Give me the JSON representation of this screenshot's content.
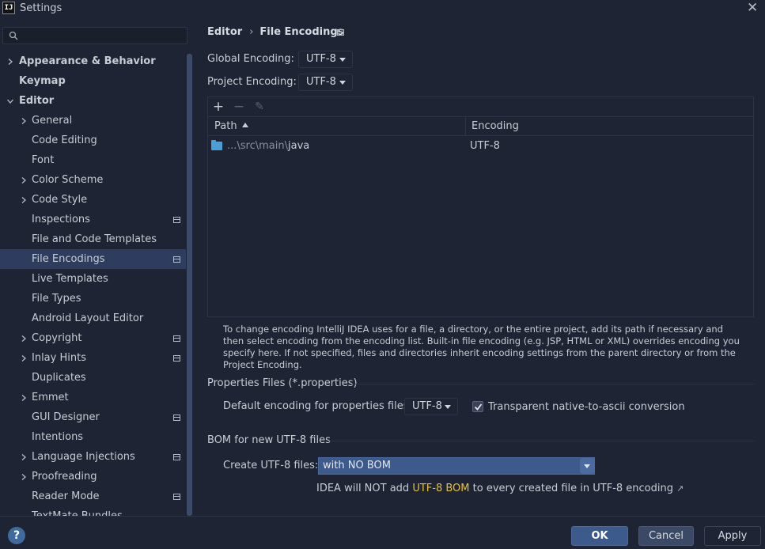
{
  "window": {
    "title": "Settings",
    "logo_text": "IJ"
  },
  "search": {
    "placeholder": ""
  },
  "sidebar": {
    "items": [
      {
        "label": "Appearance & Behavior",
        "bold": true,
        "chevron": "right",
        "indent": 0
      },
      {
        "label": "Keymap",
        "bold": true,
        "chevron": "none",
        "indent": 0
      },
      {
        "label": "Editor",
        "bold": true,
        "chevron": "down",
        "indent": 0
      },
      {
        "label": "General",
        "chevron": "right",
        "indent": 1
      },
      {
        "label": "Code Editing",
        "chevron": "none",
        "indent": 1
      },
      {
        "label": "Font",
        "chevron": "none",
        "indent": 1
      },
      {
        "label": "Color Scheme",
        "chevron": "right",
        "indent": 1
      },
      {
        "label": "Code Style",
        "chevron": "right",
        "indent": 1
      },
      {
        "label": "Inspections",
        "chevron": "none",
        "indent": 1,
        "project_icon": true
      },
      {
        "label": "File and Code Templates",
        "chevron": "none",
        "indent": 1
      },
      {
        "label": "File Encodings",
        "chevron": "none",
        "indent": 1,
        "project_icon": true,
        "selected": true
      },
      {
        "label": "Live Templates",
        "chevron": "none",
        "indent": 1
      },
      {
        "label": "File Types",
        "chevron": "none",
        "indent": 1
      },
      {
        "label": "Android Layout Editor",
        "chevron": "none",
        "indent": 1
      },
      {
        "label": "Copyright",
        "chevron": "right",
        "indent": 1,
        "project_icon": true
      },
      {
        "label": "Inlay Hints",
        "chevron": "right",
        "indent": 1,
        "project_icon": true
      },
      {
        "label": "Duplicates",
        "chevron": "none",
        "indent": 1
      },
      {
        "label": "Emmet",
        "chevron": "right",
        "indent": 1
      },
      {
        "label": "GUI Designer",
        "chevron": "none",
        "indent": 1,
        "project_icon": true
      },
      {
        "label": "Intentions",
        "chevron": "none",
        "indent": 1
      },
      {
        "label": "Language Injections",
        "chevron": "right",
        "indent": 1,
        "project_icon": true
      },
      {
        "label": "Proofreading",
        "chevron": "right",
        "indent": 1
      },
      {
        "label": "Reader Mode",
        "chevron": "none",
        "indent": 1,
        "project_icon": true
      },
      {
        "label": "TextMate Bundles",
        "chevron": "none",
        "indent": 1
      }
    ]
  },
  "breadcrumb": {
    "parent": "Editor",
    "separator": "›",
    "current": "File Encodings"
  },
  "global_encoding": {
    "label": "Global Encoding:",
    "value": "UTF-8"
  },
  "project_encoding": {
    "label": "Project Encoding:",
    "value": "UTF-8"
  },
  "toolbar": {
    "add": "+",
    "remove": "−",
    "edit": "✎"
  },
  "table": {
    "columns": {
      "path": "Path",
      "encoding": "Encoding"
    },
    "rows": [
      {
        "path_prefix": "...\\src\\main\\",
        "path_name": "java",
        "encoding": "UTF-8"
      }
    ]
  },
  "help_text": "To change encoding IntelliJ IDEA uses for a file, a directory, or the entire project, add its path if necessary and then select encoding from the encoding list. Built-in file encoding (e.g. JSP, HTML or XML) overrides encoding you specify here. If not specified, files and directories inherit encoding settings from the parent directory or from the Project Encoding.",
  "properties": {
    "section_title": "Properties Files (*.properties)",
    "default_label": "Default encoding for properties files:",
    "default_value": "UTF-8",
    "transparent_label": "Transparent native-to-ascii conversion",
    "transparent_checked": true
  },
  "bom": {
    "section_title": "BOM for new UTF-8 files",
    "create_label": "Create UTF-8 files:",
    "create_value": "with NO BOM",
    "note_prefix": "IDEA will NOT add ",
    "note_highlight": "UTF-8 BOM",
    "note_suffix": " to every created file in UTF-8 encoding",
    "note_arrow": "↗"
  },
  "buttons": {
    "help": "?",
    "ok": "OK",
    "cancel": "Cancel",
    "apply": "Apply"
  },
  "colors": {
    "accent": "#3d5a8c",
    "highlight": "#e8c22e",
    "folder": "#4a9fd8"
  }
}
